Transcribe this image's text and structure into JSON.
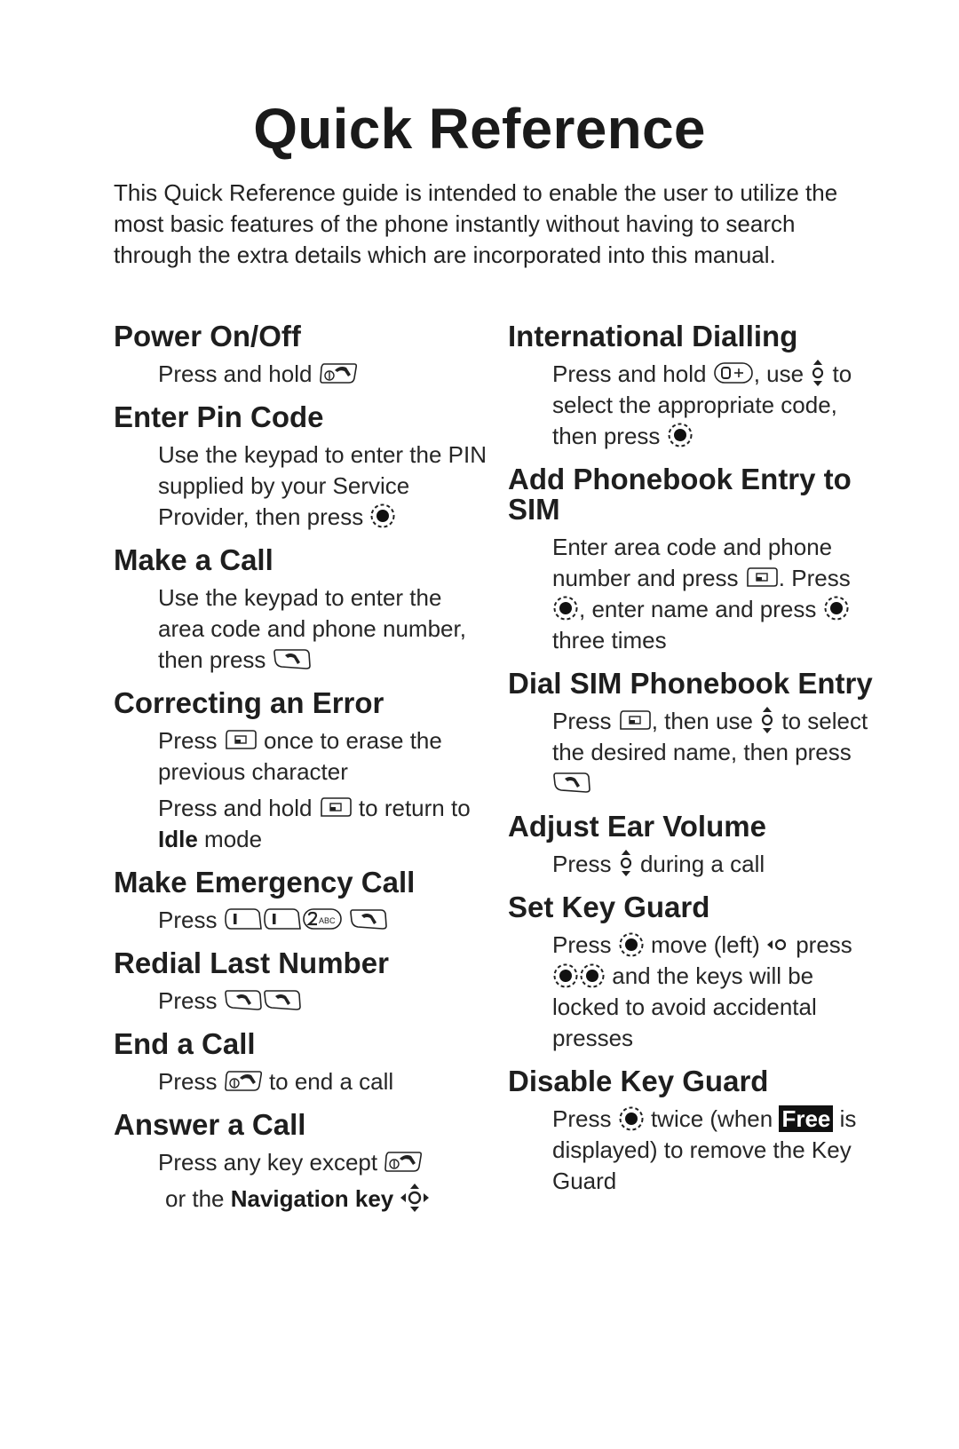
{
  "title": "Quick Reference",
  "intro": "This Quick Reference guide is intended to enable the user to utilize the most basic features of the phone instantly without having to search through the extra details which are incorporated into this manual.",
  "left_sections": {
    "power": {
      "heading": "Power On/Off",
      "t1": "Press and hold",
      "icons": [
        "power-end-key-icon"
      ]
    },
    "pin": {
      "heading": "Enter Pin Code",
      "t1": "Use the keypad to enter the PIN supplied by your Service Provider, then press",
      "icons": [
        "select-key-icon"
      ]
    },
    "call": {
      "heading": "Make a Call",
      "t1": "Use the keypad to enter the area code and phone number, then press",
      "icons": [
        "send-key-icon"
      ]
    },
    "error": {
      "heading": "Correcting an Error",
      "t1": "Press",
      "t2": "once to erase the previous character",
      "t3": "Press and hold",
      "t4": "to return to",
      "t5": "Idle",
      "t6": "mode",
      "icons": [
        "clear-key-icon"
      ]
    },
    "emergency": {
      "heading": "Make Emergency Call",
      "t1": "Press",
      "keys": [
        "1",
        "1",
        "2ABC"
      ],
      "icons": [
        "key-1-icon",
        "key-1-icon",
        "key-2abc-icon",
        "send-key-icon"
      ]
    },
    "redial": {
      "heading": "Redial Last Number",
      "t1": "Press",
      "icons": [
        "send-key-icon",
        "send-key-icon"
      ]
    },
    "end": {
      "heading": "End a Call",
      "t1": "Press",
      "t2": "to end a call",
      "icons": [
        "power-end-key-icon"
      ]
    },
    "answer": {
      "heading": "Answer a Call",
      "t1": "Press any key except",
      "t2": "or the",
      "t3": "Navigation key",
      "icons": [
        "power-end-key-icon",
        "navigation-key-icon"
      ]
    }
  },
  "right_sections": {
    "intl": {
      "heading": "International Dialling",
      "t1": "Press and hold",
      "t2": ", use",
      "t3": "to select the appropriate code, then press",
      "key0": "0+",
      "icons": [
        "key-0-plus-icon",
        "up-down-nav-icon",
        "select-key-icon"
      ]
    },
    "addpb": {
      "heading": "Add Phonebook Entry to SIM",
      "t1": "Enter area code and phone number and press",
      "t2": ". Press",
      "t3": ", enter name and press",
      "t4": "three times",
      "icons": [
        "clear-key-icon",
        "select-key-icon",
        "select-key-icon"
      ]
    },
    "dialsim": {
      "heading": "Dial SIM Phonebook Entry",
      "t1": "Press",
      "t2": ", then use",
      "t3": "to select the desired name, then press",
      "icons": [
        "clear-key-icon",
        "up-down-nav-icon",
        "send-key-icon"
      ]
    },
    "volume": {
      "heading": "Adjust Ear Volume",
      "t1": "Press",
      "t2": "during a call",
      "icons": [
        "up-down-nav-icon"
      ]
    },
    "setguard": {
      "heading": "Set Key Guard",
      "t1": "Press",
      "t2": "move (left)",
      "t3": "press",
      "t4": "and the keys will be locked to avoid accidental presses",
      "icons": [
        "select-key-icon",
        "left-nav-icon",
        "select-key-icon",
        "select-key-icon"
      ]
    },
    "disguard": {
      "heading": "Disable Key Guard",
      "t1": "Press",
      "t2": "twice (when",
      "badge": "Free",
      "t3": "is displayed) to remove the Key Guard",
      "icons": [
        "select-key-icon"
      ]
    }
  }
}
